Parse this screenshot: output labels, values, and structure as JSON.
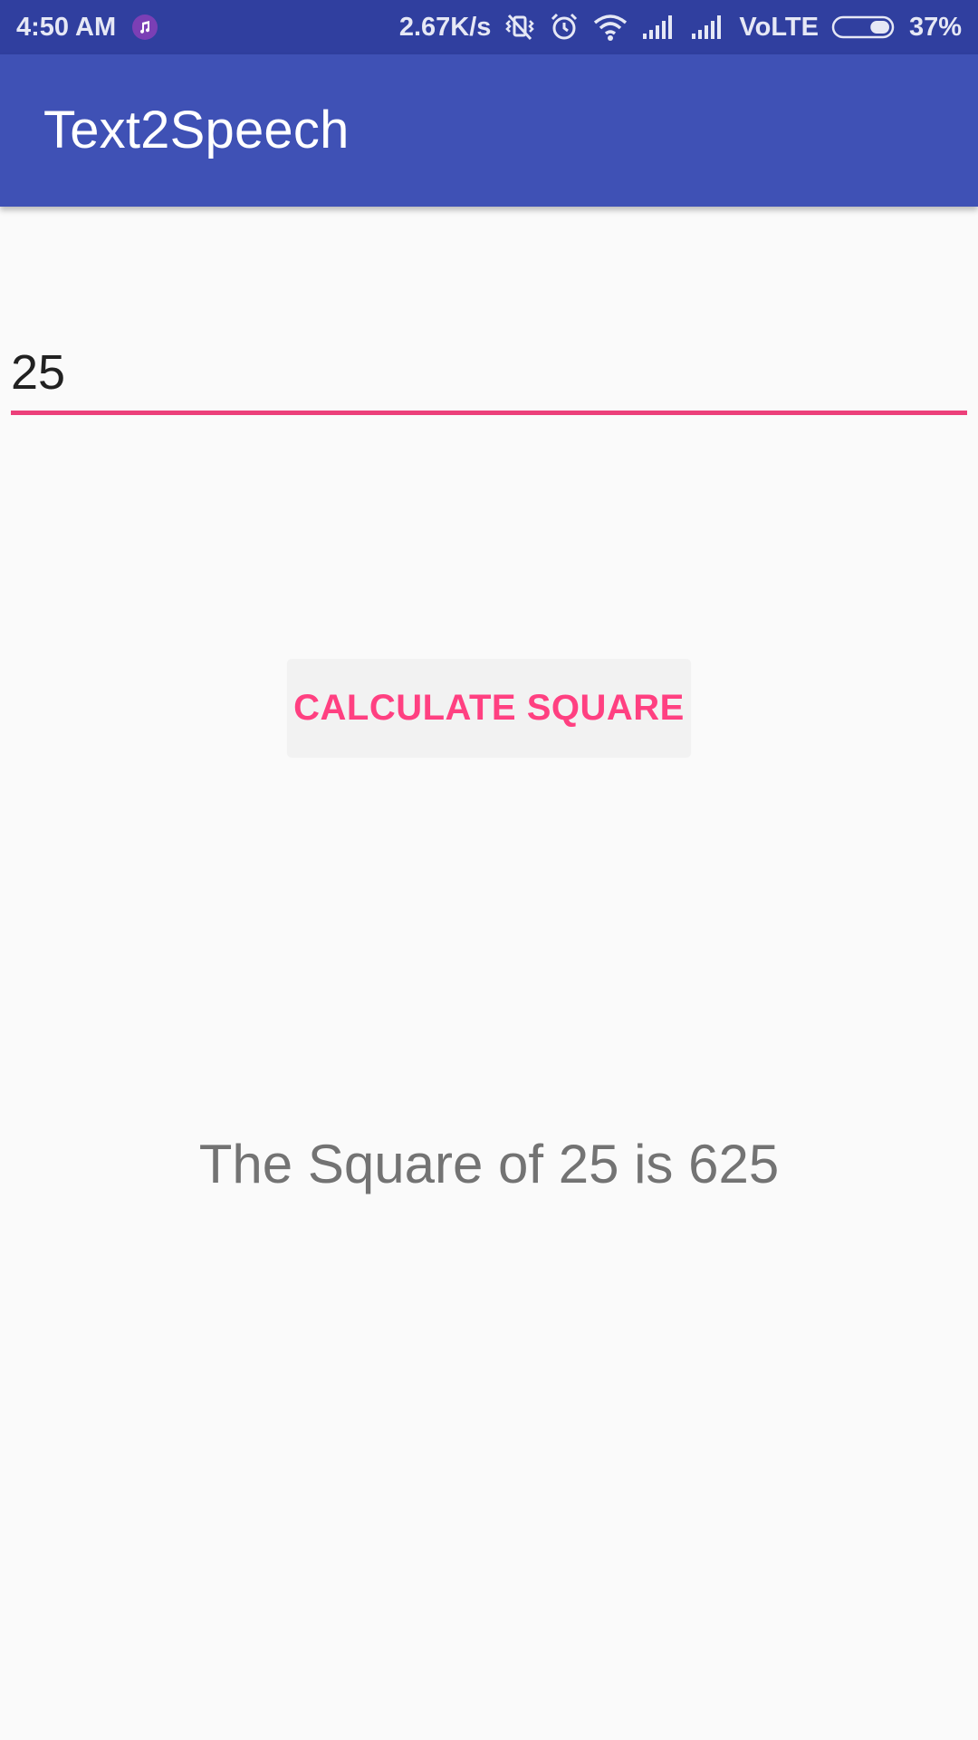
{
  "status_bar": {
    "time": "4:50 AM",
    "network_speed": "2.67K/s",
    "network_type": "VoLTE",
    "battery_percent": "37%",
    "battery_level": 0.37,
    "icons": [
      "music-notification-icon",
      "vibrate-silent-icon",
      "alarm-icon",
      "wifi-icon",
      "signal-icon",
      "signal-icon",
      "battery-icon"
    ]
  },
  "app_bar": {
    "title": "Text2Speech",
    "color": "#3f51b5",
    "status_color": "#303f9f"
  },
  "input": {
    "value": "25",
    "accent_color": "#ec407a"
  },
  "button": {
    "label": "CALCULATE SQUARE",
    "text_color": "#ff4081"
  },
  "result": {
    "text": "The Square of 25 is 625"
  }
}
